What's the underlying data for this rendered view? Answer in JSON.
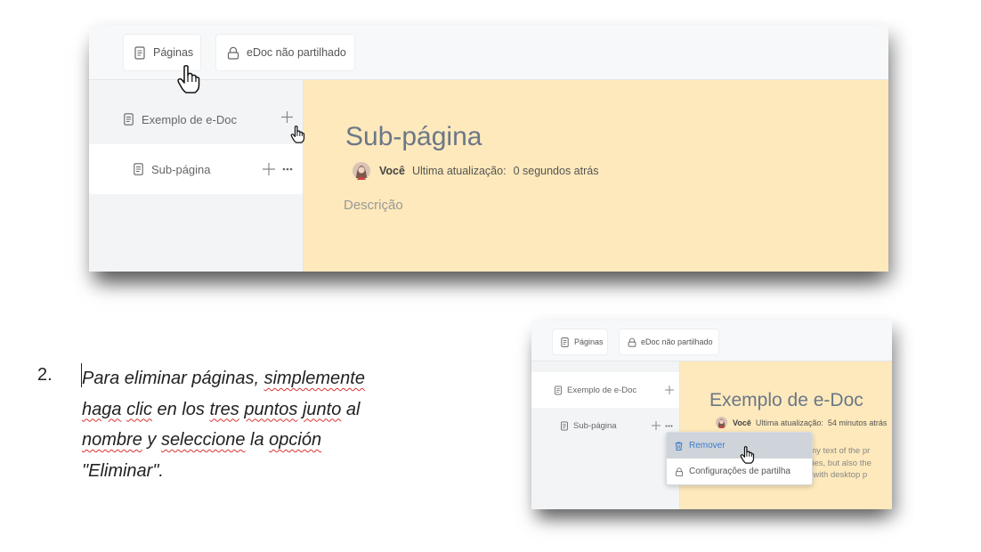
{
  "screenshot1": {
    "toolbar": {
      "pages_label": "Páginas",
      "share_status_label": "eDoc não partilhado"
    },
    "sidebar": {
      "items": [
        {
          "label": "Exemplo de e-Doc",
          "add_icon": "plus-icon"
        },
        {
          "label": "Sub-página",
          "add_icon": "plus-icon",
          "more_icon": "more-dots-icon"
        }
      ]
    },
    "page": {
      "title": "Sub-página",
      "author": "Você",
      "updated_label": "Ultima atualização:",
      "updated_value": "0 segundos atrás",
      "description_placeholder": "Descrição"
    }
  },
  "screenshot2": {
    "toolbar": {
      "pages_label": "Páginas",
      "share_status_label": "eDoc não partilhado"
    },
    "sidebar": {
      "items": [
        {
          "label": "Exemplo de e-Doc"
        },
        {
          "label": "Sub-página"
        }
      ]
    },
    "page": {
      "title": "Exemplo de e-Doc",
      "author": "Você",
      "updated_label": "Ultima atualização:",
      "updated_value": "54 minutos atrás",
      "body_fragments": [
        "ummy text of the pr",
        "nturies, but also the",
        "ntly with desktop p"
      ]
    },
    "context_menu": {
      "items": [
        {
          "label": "Remover",
          "icon": "trash-icon",
          "state": "hover"
        },
        {
          "label": "Configurações de partilha",
          "icon": "lock-icon"
        }
      ]
    }
  },
  "instruction": {
    "number": "2.",
    "lines": [
      [
        "Para eliminar páginas, ",
        "simplemente"
      ],
      [
        "haga",
        " ",
        "clic",
        " en los ",
        "tres",
        " ",
        "puntos",
        " ",
        "junto",
        " al"
      ],
      [
        "nombre",
        " y ",
        "seleccione",
        " la ",
        "opción"
      ],
      [
        "\"Eliminar\"."
      ]
    ]
  },
  "colors": {
    "content_background": "#fde9bb",
    "sidebar_background": "#f2f4f5",
    "hover_background": "#ced4da",
    "accent_blue": "#3d7cc9",
    "spellcheck_red": "#d33"
  }
}
